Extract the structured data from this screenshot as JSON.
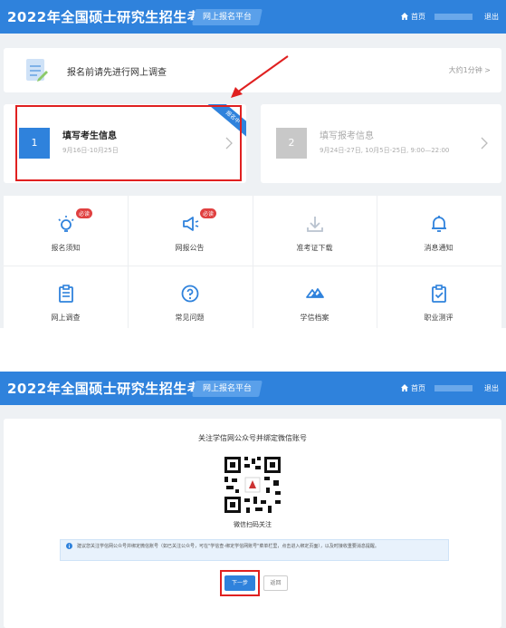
{
  "colors": {
    "primary": "#2f82dc",
    "required_badge": "#e04040",
    "highlight": "#e02020"
  },
  "screen1": {
    "header": {
      "title": "2022年全国硕士研究生招生考试",
      "platform_badge": "网上报名平台",
      "home": "首页",
      "logout": "退出"
    },
    "survey": {
      "text": "报名前请先进行网上调查",
      "time": "大约1分钟"
    },
    "steps": [
      {
        "number": "1",
        "title": "填写考生信息",
        "date": "9月16日-10月25日",
        "ribbon": "报名中"
      },
      {
        "number": "2",
        "title": "填写报考信息",
        "date": "9月24日-27日, 10月5日-25日, 9:00—22:00"
      }
    ],
    "menu": [
      {
        "label": "报名须知",
        "icon": "lightbulb-icon",
        "badge": "必读"
      },
      {
        "label": "网报公告",
        "icon": "megaphone-icon",
        "badge": "必读"
      },
      {
        "label": "准考证下载",
        "icon": "download-icon"
      },
      {
        "label": "消息通知",
        "icon": "bell-icon"
      },
      {
        "label": "网上调查",
        "icon": "clipboard-icon"
      },
      {
        "label": "常见问题",
        "icon": "question-icon"
      },
      {
        "label": "学信档案",
        "icon": "archive-logo-icon"
      },
      {
        "label": "职业测评",
        "icon": "assessment-icon"
      }
    ]
  },
  "screen2": {
    "header": {
      "title": "2022年全国硕士研究生招生考试",
      "platform_badge": "网上报名平台",
      "home": "首页",
      "logout": "退出"
    },
    "title": "关注学信网公众号并绑定微信账号",
    "qr_caption": "微信扫码关注",
    "notice": "建议您关注学信网公众号并绑定微信账号（如已关注公众号，可在\"学信查-绑定学信网账号\"菜单栏里，点击进入绑定页面），以及时接收重要消息提醒。",
    "next_button": "下一步",
    "back_button": "返回"
  }
}
